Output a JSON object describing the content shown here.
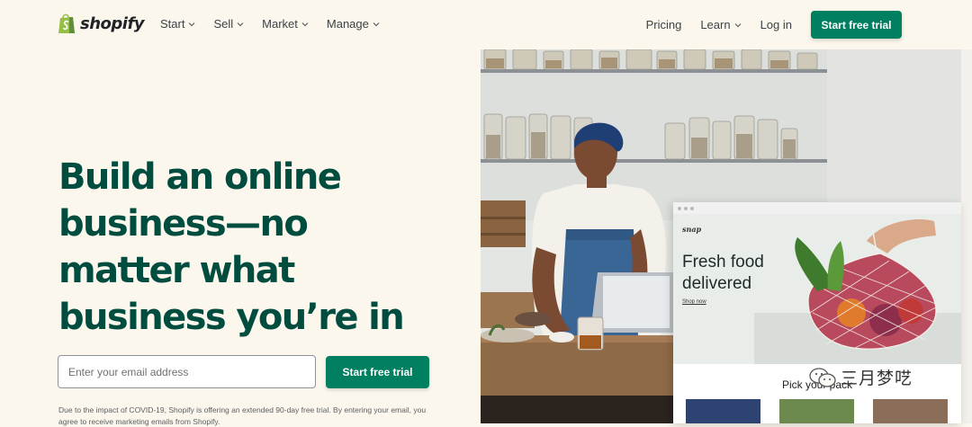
{
  "nav": {
    "logo_text": "shopify",
    "left_links": [
      {
        "label": "Start"
      },
      {
        "label": "Sell"
      },
      {
        "label": "Market"
      },
      {
        "label": "Manage"
      }
    ],
    "pricing": "Pricing",
    "learn": "Learn",
    "login": "Log in",
    "cta": "Start free trial"
  },
  "hero": {
    "headline": "Build an online business—no matter what business you’re in",
    "email_placeholder": "Enter your email address",
    "email_value": "",
    "cta": "Start free trial",
    "disclaimer": "Due to the impact of COVID-19, Shopify is offering an extended 90-day free trial. By entering your email, you agree to receive marketing emails from Shopify."
  },
  "mockup": {
    "brand": "snap",
    "title": "Fresh food delivered",
    "link": "Shop now",
    "section": "Pick your pack"
  },
  "watermark": {
    "text": "三月梦呓"
  },
  "colors": {
    "brand_green": "#008060",
    "headline_green": "#004c3f",
    "background": "#fbf7ed"
  }
}
